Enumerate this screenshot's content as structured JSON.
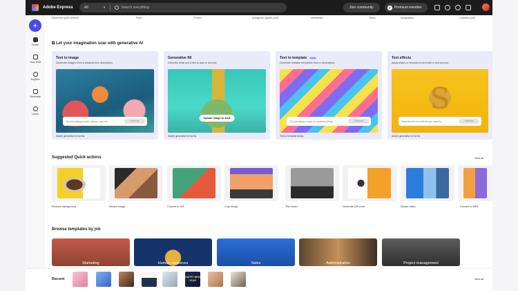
{
  "header": {
    "brand": "Adobe Express",
    "search_scope": "All",
    "search_placeholder": "Search everything",
    "join_label": "Join community",
    "premium_label": "Premium member",
    "premium_badge": "P"
  },
  "rail": {
    "create_label": "+",
    "items": [
      {
        "label": "Home"
      },
      {
        "label": "Your stuff"
      },
      {
        "label": "Explore"
      },
      {
        "label": "Schedule"
      },
      {
        "label": "Learn"
      }
    ]
  },
  "top_strip": [
    "Start from your content",
    "Flyer",
    "Poster",
    "Instagram square post",
    "Newsletter",
    "Video",
    "Infographic",
    "LinkedIn post"
  ],
  "gen_ai": {
    "title": "Let your imagination soar with generative AI",
    "cards": [
      {
        "title": "Text to image",
        "desc": "Generate images from a detailed text description.",
        "prompt": "Try describing people, places, and mo...",
        "button": "Generate",
        "footer": "Adobe generative AI terms"
      },
      {
        "title": "Generative fill",
        "desc": "Describe what you'd like to add or remove.",
        "upload": "Upload image to start",
        "footer": "Adobe generative AI terms"
      },
      {
        "title": "Text to template",
        "beta": "BETA",
        "desc": "Generate editable templates from a description.",
        "prompt": "Try specifying a topic or occasion (Biog...",
        "button": "Generate",
        "footer": "Text to template terms"
      },
      {
        "title": "Text effects",
        "desc": "Apply styles or textures to text with a text prompt.",
        "glyph": "S",
        "prompt": "Describe the text effects you want to...",
        "button": "Generate",
        "footer": "Adobe generative AI terms"
      }
    ]
  },
  "quick_actions": {
    "title": "Suggested Quick actions",
    "view_all": "View all",
    "items": [
      "Remove background",
      "Resize image",
      "Convert to GIF",
      "Crop image",
      "Trim video",
      "Generate QR code",
      "Resize video",
      "Convert to MP4"
    ]
  },
  "jobs": {
    "title": "Browse templates by job",
    "items": [
      "Marketing",
      "Human resources",
      "Sales",
      "Administration",
      "Project management"
    ]
  },
  "recent": {
    "title": "Recent",
    "view_all": "View all",
    "thumb_text": "HAPPY NEW YEAR"
  }
}
